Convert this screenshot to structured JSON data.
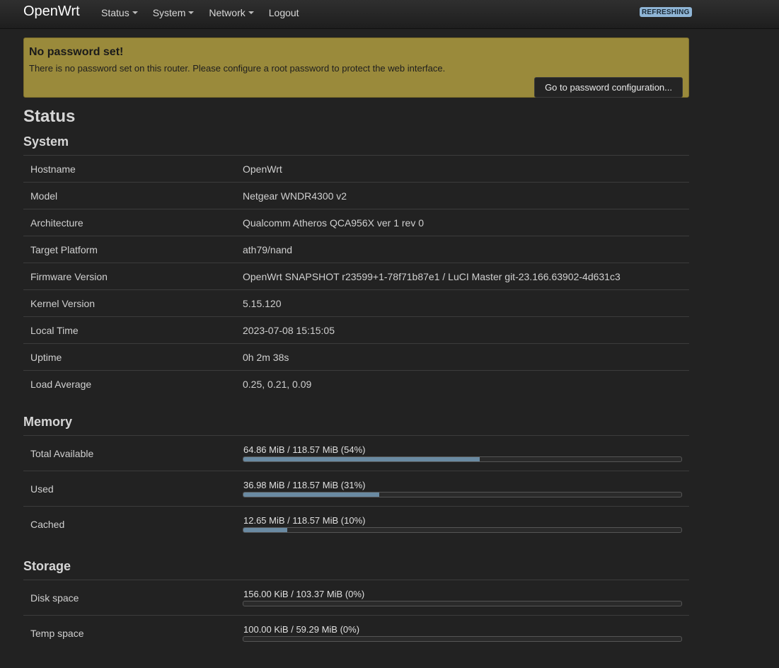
{
  "brand": "OpenWrt",
  "nav": [
    {
      "label": "Status",
      "dropdown": true
    },
    {
      "label": "System",
      "dropdown": true
    },
    {
      "label": "Network",
      "dropdown": true
    },
    {
      "label": "Logout",
      "dropdown": false
    }
  ],
  "refresh_badge": "REFRESHING",
  "alert": {
    "title": "No password set!",
    "message": "There is no password set on this router. Please configure a root password to protect the web interface.",
    "button": "Go to password configuration..."
  },
  "page_title": "Status",
  "system": {
    "title": "System",
    "rows": [
      {
        "key": "Hostname",
        "value": "OpenWrt"
      },
      {
        "key": "Model",
        "value": "Netgear WNDR4300 v2"
      },
      {
        "key": "Architecture",
        "value": "Qualcomm Atheros QCA956X ver 1 rev 0"
      },
      {
        "key": "Target Platform",
        "value": "ath79/nand"
      },
      {
        "key": "Firmware Version",
        "value": "OpenWrt SNAPSHOT r23599+1-78f71b87e1 / LuCI Master git-23.166.63902-4d631c3"
      },
      {
        "key": "Kernel Version",
        "value": "5.15.120"
      },
      {
        "key": "Local Time",
        "value": "2023-07-08 15:15:05"
      },
      {
        "key": "Uptime",
        "value": "0h 2m 38s"
      },
      {
        "key": "Load Average",
        "value": "0.25, 0.21, 0.09"
      }
    ]
  },
  "memory": {
    "title": "Memory",
    "rows": [
      {
        "key": "Total Available",
        "label": "64.86 MiB / 118.57 MiB (54%)",
        "percent": 54
      },
      {
        "key": "Used",
        "label": "36.98 MiB / 118.57 MiB (31%)",
        "percent": 31
      },
      {
        "key": "Cached",
        "label": "12.65 MiB / 118.57 MiB (10%)",
        "percent": 10
      }
    ]
  },
  "storage": {
    "title": "Storage",
    "rows": [
      {
        "key": "Disk space",
        "label": "156.00 KiB / 103.37 MiB (0%)",
        "percent": 0
      },
      {
        "key": "Temp space",
        "label": "100.00 KiB / 59.29 MiB (0%)",
        "percent": 0
      }
    ]
  },
  "colors": {
    "background": "#222222",
    "alert": "#9a8a3b",
    "bar_fill": "#6a8aa2",
    "badge": "#8fb5d6"
  }
}
